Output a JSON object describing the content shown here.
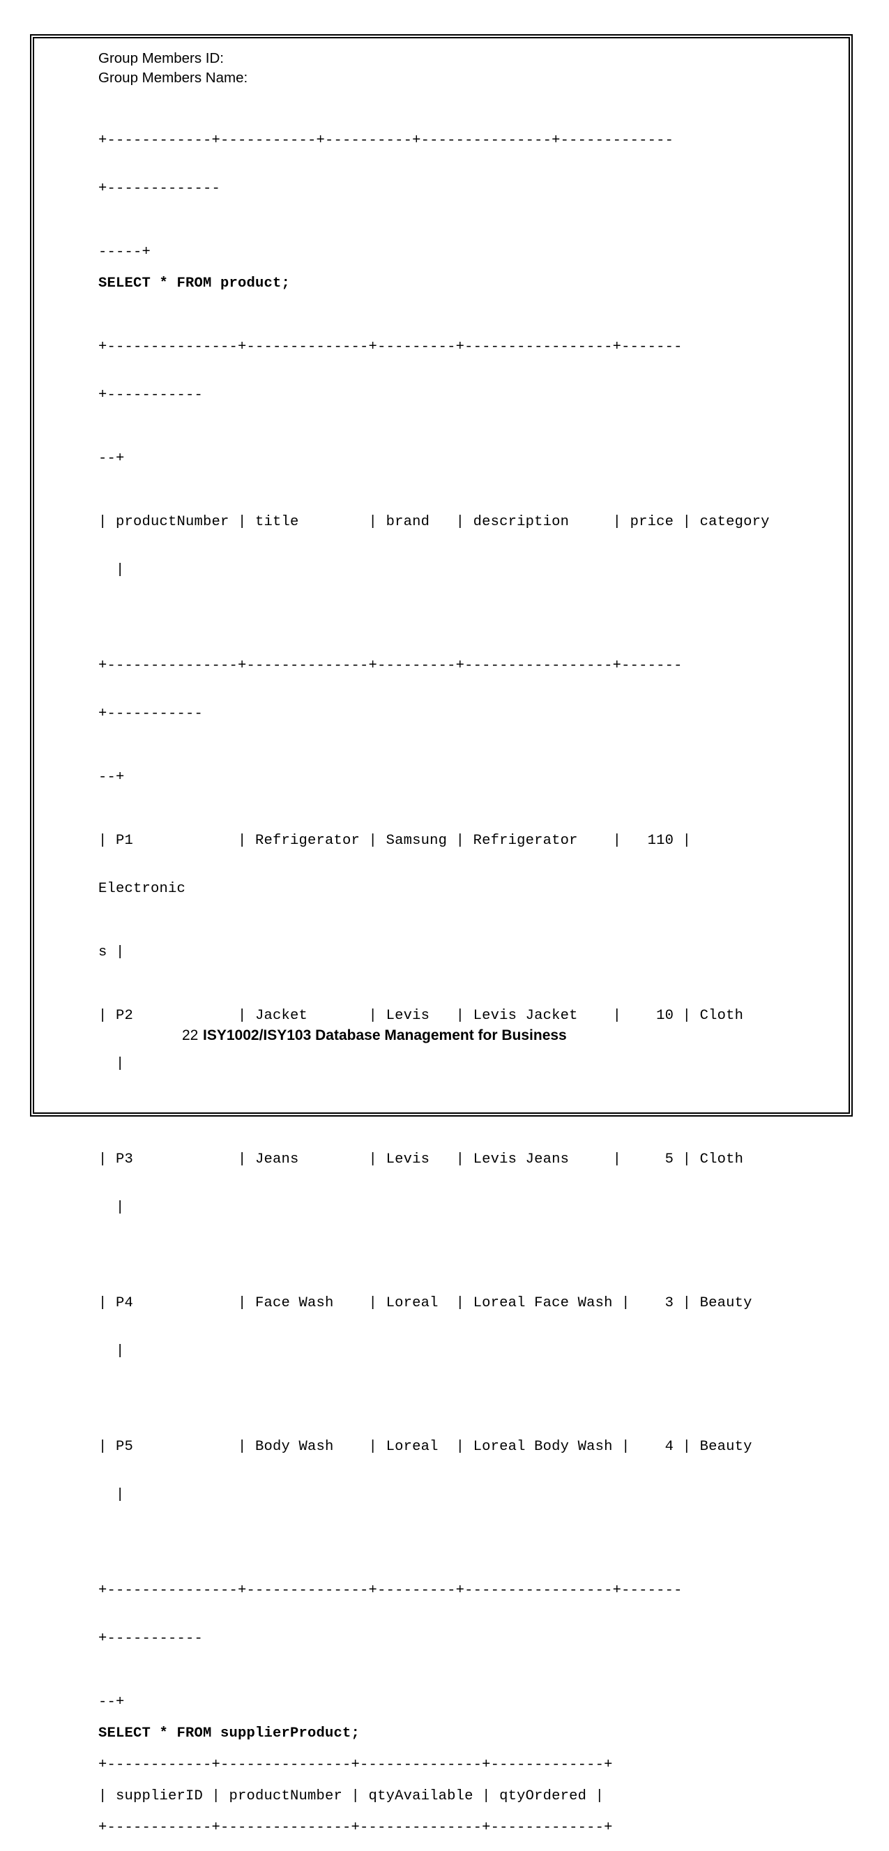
{
  "page": {
    "border_color": "#000000",
    "background": "#ffffff"
  },
  "header": {
    "group_members_id_label": "Group Members ID:",
    "group_members_name_label": "Group Members Name:"
  },
  "console": {
    "leading_separator_line1": "+------------+-----------+----------+---------------+-------------",
    "leading_separator_line2": "+-------------",
    "leading_separator_line3": "-----+",
    "product_query": "SELECT * FROM product;",
    "product_separator_line1": "+---------------+--------------+---------+-----------------+-------",
    "product_separator_line2": "+-----------",
    "product_separator_line3": "--+",
    "product_header_line1": "| productNumber | title        | brand   | description     | price | category",
    "product_header_line2": "  |",
    "product_rows": [
      {
        "line1": "| P1            | Refrigerator | Samsung | Refrigerator    |   110 |",
        "line2": "Electronic",
        "line3": "s |"
      },
      {
        "line1": "| P2            | Jacket       | Levis   | Levis Jacket    |    10 | Cloth",
        "line2": "  |"
      },
      {
        "line1": "| P3            | Jeans        | Levis   | Levis Jeans     |     5 | Cloth",
        "line2": "  |"
      },
      {
        "line1": "| P4            | Face Wash    | Loreal  | Loreal Face Wash |    3 | Beauty",
        "line2": "  |"
      },
      {
        "line1": "| P5            | Body Wash    | Loreal  | Loreal Body Wash |    4 | Beauty",
        "line2": "  |"
      }
    ],
    "product_footer_line1": "+---------------+--------------+---------+-----------------+-------",
    "product_footer_line2": "+-----------",
    "product_footer_line3": "--+",
    "supplier_query": "SELECT * FROM supplierProduct;",
    "supplier_separator_top": "+------------+---------------+--------------+-------------+",
    "supplier_header": "| supplierID | productNumber | qtyAvailable | qtyOrdered |",
    "supplier_separator_bottom": "+------------+---------------+--------------+-------------+"
  },
  "footer": {
    "page_number": "22",
    "course_title": "ISY1002/ISY103 Database Management for Business"
  },
  "table_data": {
    "product": {
      "columns": [
        "productNumber",
        "title",
        "brand",
        "description",
        "price",
        "category"
      ],
      "rows": [
        [
          "P1",
          "Refrigerator",
          "Samsung",
          "Refrigerator",
          "110",
          "Electronics"
        ],
        [
          "P2",
          "Jacket",
          "Levis",
          "Levis Jacket",
          "10",
          "Cloth"
        ],
        [
          "P3",
          "Jeans",
          "Levis",
          "Levis Jeans",
          "5",
          "Cloth"
        ],
        [
          "P4",
          "Face Wash",
          "Loreal",
          "Loreal Face Wash",
          "3",
          "Beauty"
        ],
        [
          "P5",
          "Body Wash",
          "Loreal",
          "Loreal Body Wash",
          "4",
          "Beauty"
        ]
      ]
    },
    "supplierProduct": {
      "columns": [
        "supplierID",
        "productNumber",
        "qtyAvailable",
        "qtyOrdered"
      ],
      "rows": []
    }
  }
}
